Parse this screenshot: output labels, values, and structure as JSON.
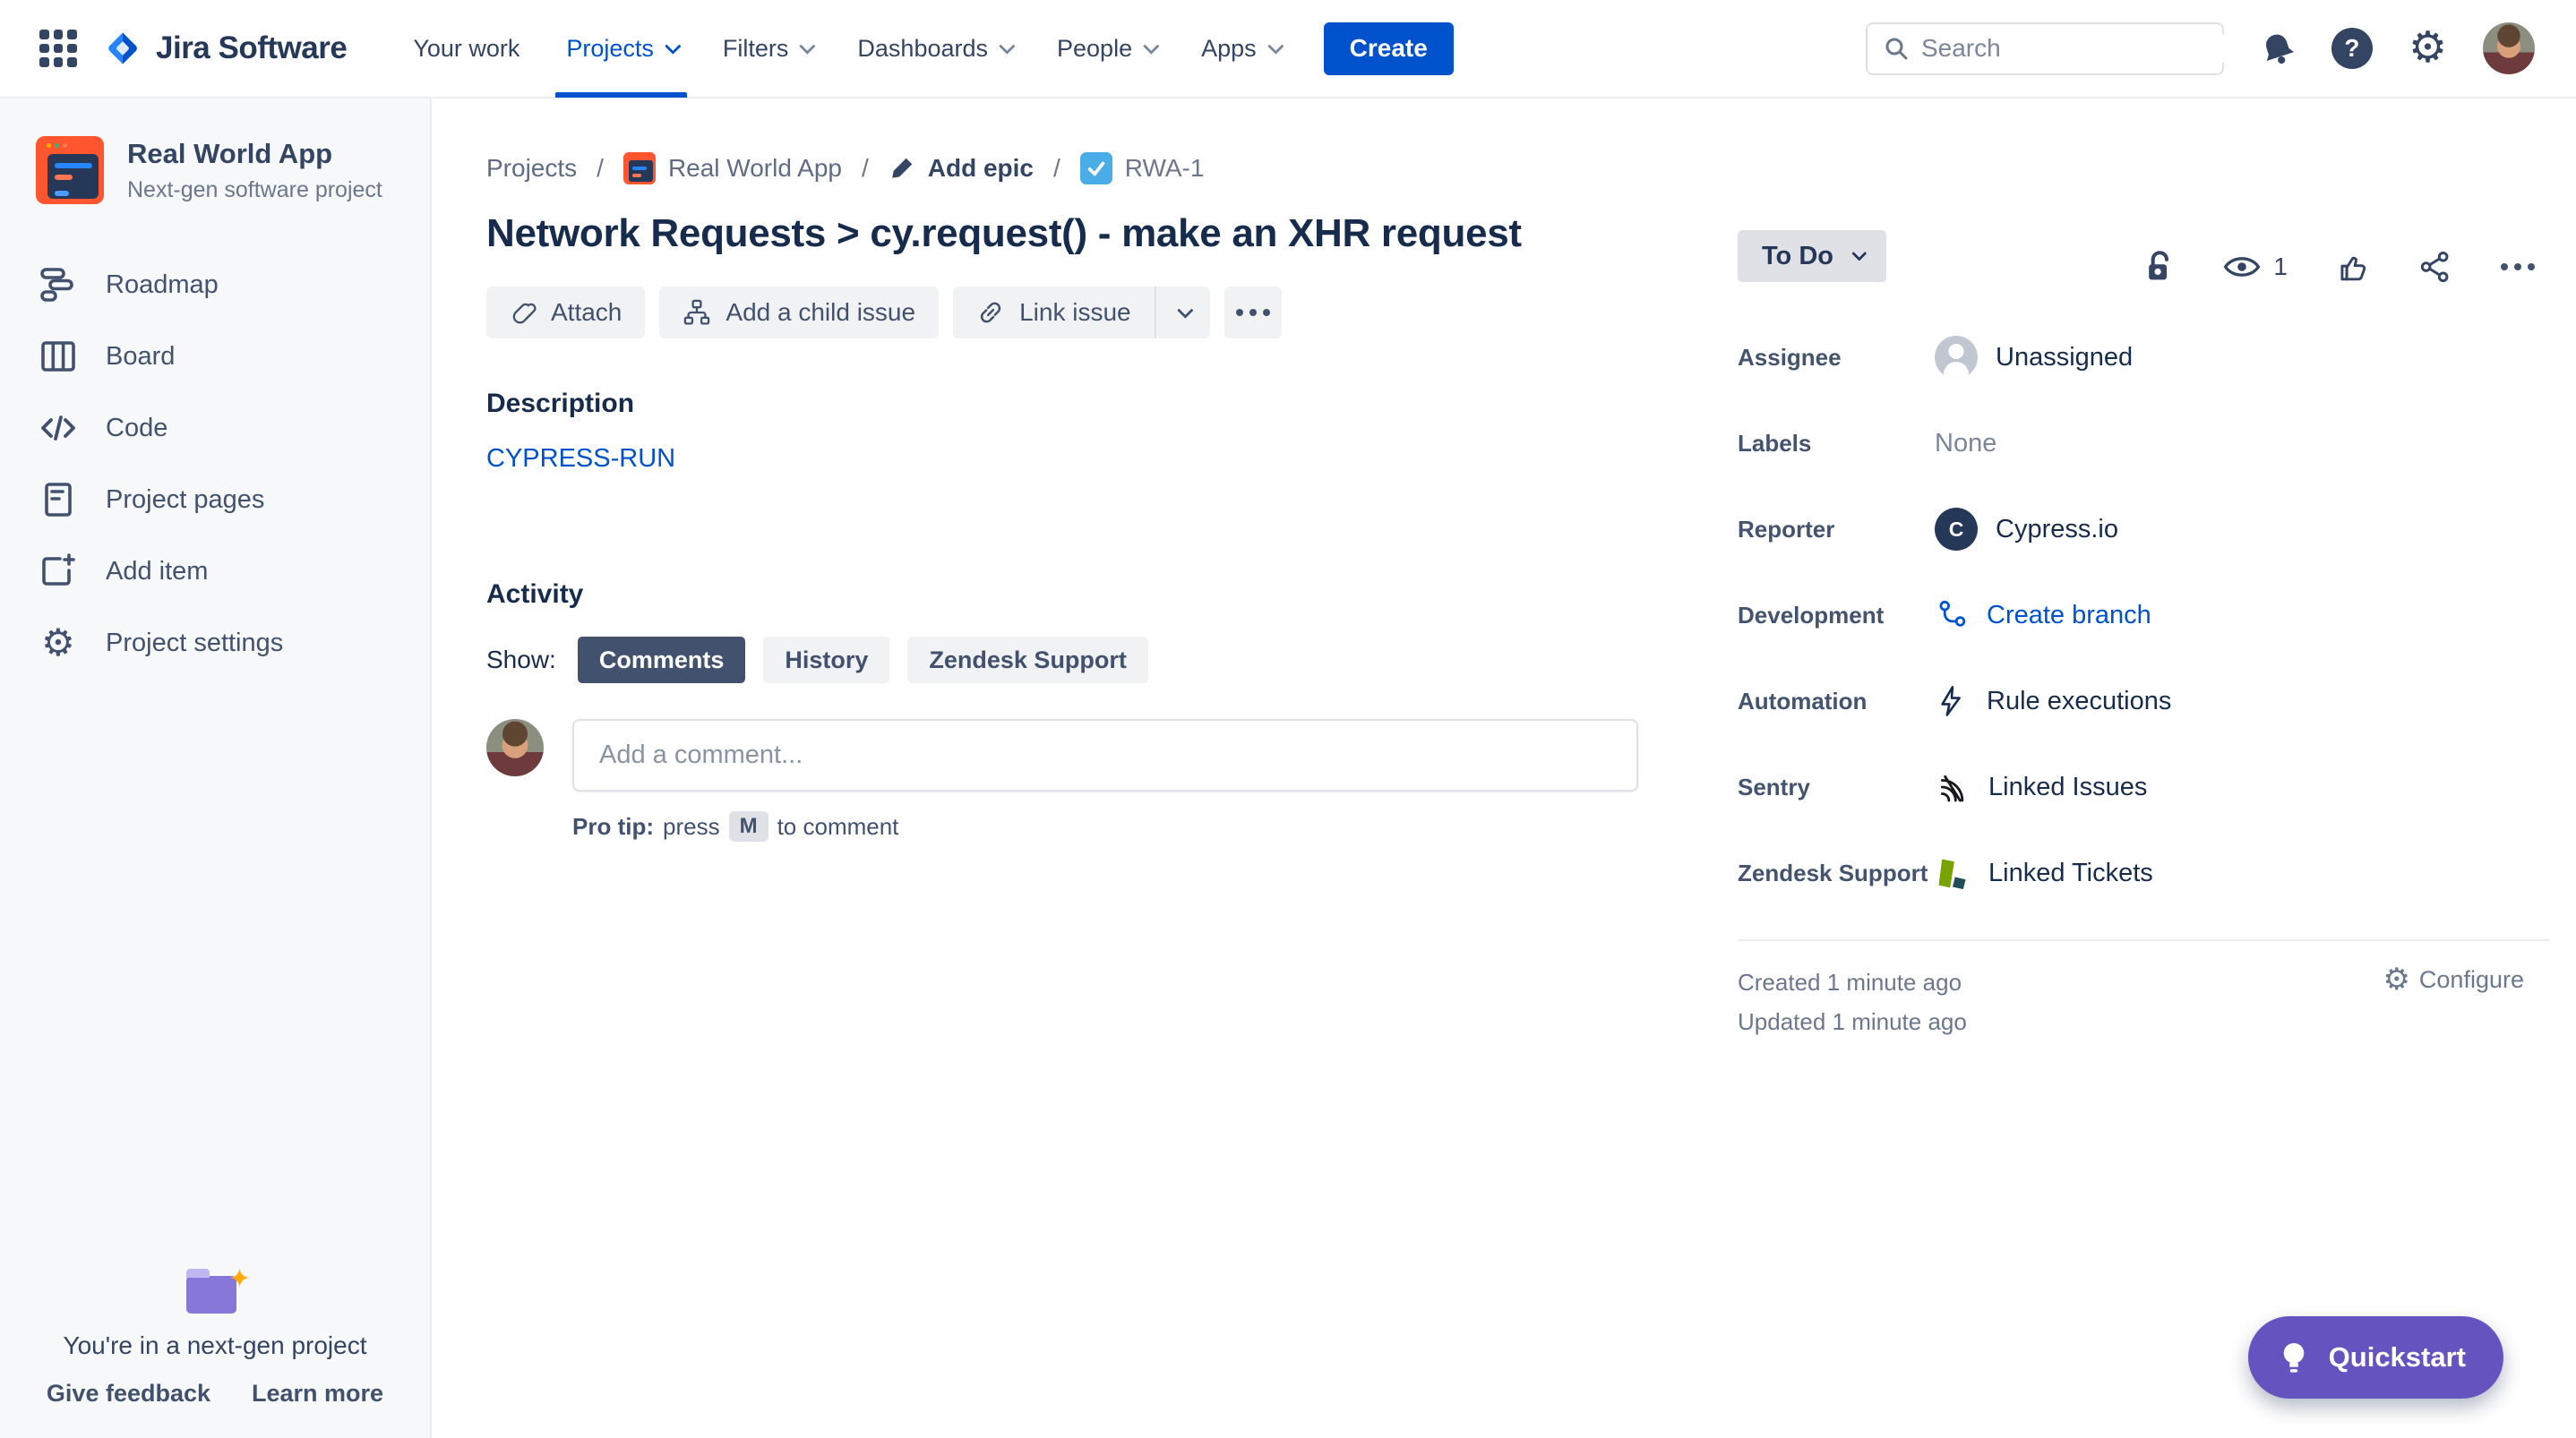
{
  "topnav": {
    "logo_text": "Jira Software",
    "items": [
      {
        "label": "Your work",
        "chevron": false,
        "active": false
      },
      {
        "label": "Projects",
        "chevron": true,
        "active": true
      },
      {
        "label": "Filters",
        "chevron": true,
        "active": false
      },
      {
        "label": "Dashboards",
        "chevron": true,
        "active": false
      },
      {
        "label": "People",
        "chevron": true,
        "active": false
      },
      {
        "label": "Apps",
        "chevron": true,
        "active": false
      }
    ],
    "create_label": "Create",
    "search": {
      "placeholder": "Search"
    },
    "right_icons": [
      "notification-bell-icon",
      "help-icon",
      "settings-gear-icon",
      "user-avatar"
    ]
  },
  "sidebar": {
    "project_name": "Real World App",
    "project_type": "Next-gen software project",
    "items": [
      {
        "label": "Roadmap",
        "icon": "roadmap-icon"
      },
      {
        "label": "Board",
        "icon": "board-icon"
      },
      {
        "label": "Code",
        "icon": "code-icon"
      },
      {
        "label": "Project pages",
        "icon": "pages-icon"
      },
      {
        "label": "Add item",
        "icon": "add-item-icon"
      },
      {
        "label": "Project settings",
        "icon": "gear-icon"
      }
    ],
    "footer": {
      "message": "You're in a next-gen project",
      "links": [
        "Give feedback",
        "Learn more"
      ]
    }
  },
  "breadcrumb": {
    "items": [
      "Projects",
      "Real World App",
      "Add epic",
      "RWA-1"
    ],
    "separator": "/"
  },
  "issue": {
    "title": "Network Requests > cy.request() - make an XHR request",
    "watchers_count": "1",
    "actions": [
      "Attach",
      "Add a child issue",
      "Link issue"
    ],
    "description_label": "Description",
    "description_link": "CYPRESS-RUN",
    "activity_label": "Activity",
    "show_label": "Show:",
    "filters": [
      {
        "label": "Comments",
        "selected": true
      },
      {
        "label": "History",
        "selected": false
      },
      {
        "label": "Zendesk Support",
        "selected": false
      }
    ],
    "comment": {
      "placeholder": "Add a comment..."
    },
    "protip": {
      "prefix": "Pro tip:",
      "press": "press",
      "key": "M",
      "suffix": "to comment"
    }
  },
  "details": {
    "status": "To Do",
    "fields": [
      {
        "label": "Assignee",
        "value": "Unassigned",
        "icon": "person-avatar"
      },
      {
        "label": "Labels",
        "value": "None",
        "icon": "none"
      },
      {
        "label": "Reporter",
        "value": "Cypress.io",
        "icon": "cypress-avatar"
      },
      {
        "label": "Development",
        "value": "Create branch",
        "icon": "branch-icon"
      },
      {
        "label": "Automation",
        "value": "Rule executions",
        "icon": "lightning-icon"
      },
      {
        "label": "Sentry",
        "value": "Linked Issues",
        "icon": "sentry-icon"
      },
      {
        "label": "Zendesk Support",
        "value": "Linked Tickets",
        "icon": "zendesk-icon"
      }
    ],
    "created": "Created 1 minute ago",
    "updated": "Updated 1 minute ago",
    "configure_label": "Configure"
  },
  "quickstart": {
    "label": "Quickstart",
    "icon": "lightbulb-icon"
  },
  "colors": {
    "accent_blue": "#0052CC",
    "text_dark": "#172B4D",
    "text_slate": "#42526E",
    "text_gray": "#6B778C",
    "status_bg": "#DFE1E6",
    "selected_pill_bg": "#42526E",
    "quickstart_purple": "#6554C0",
    "task_icon_blue": "#4BADE8",
    "project_icon_orange": "#FF5630",
    "zendesk_green": "#78A300",
    "folder_purple": "#8777D9"
  }
}
